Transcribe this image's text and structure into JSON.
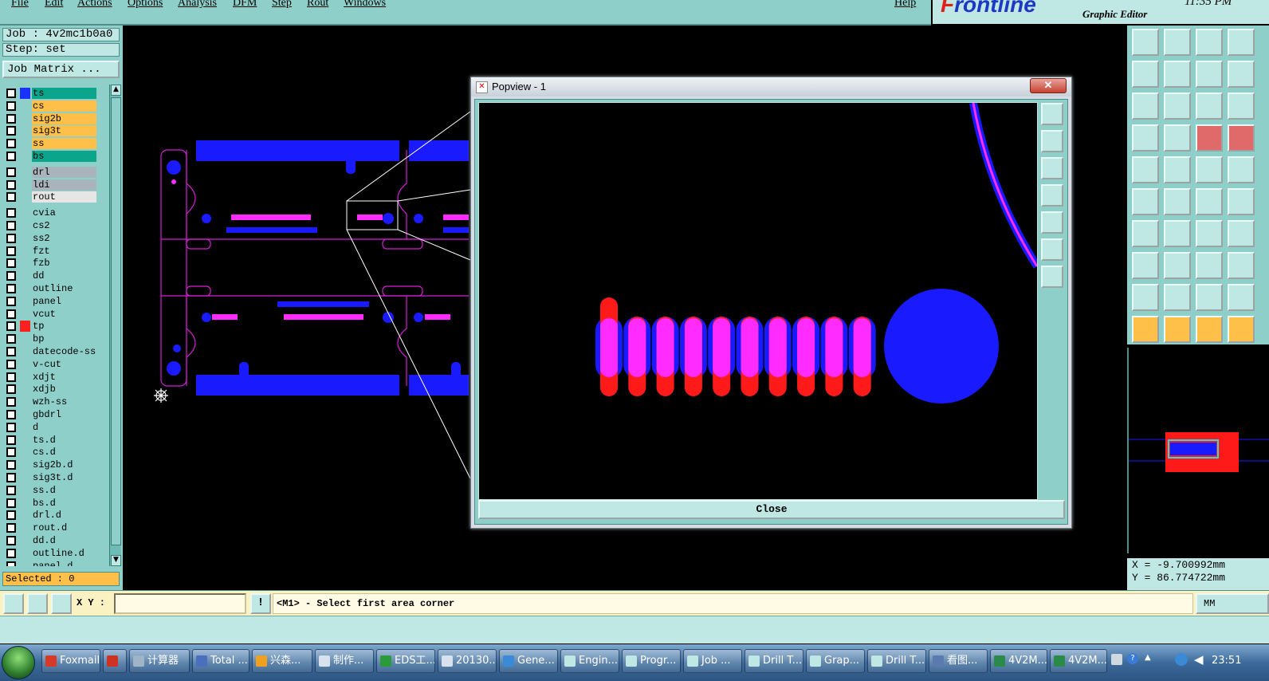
{
  "menu": [
    "File",
    "Edit",
    "Actions",
    "Options",
    "Analysis",
    "DFM",
    "Step",
    "Rout",
    "Windows"
  ],
  "help": "Help",
  "brand": {
    "logo_prefix": "F",
    "logo_rest": "rontline",
    "subtitle": "Graphic Editor",
    "clock": "11:35 PM"
  },
  "job": {
    "job_line": "Job : 4v2mc1b0a0",
    "step_line": "Step: set",
    "matrix_button": "Job Matrix ..."
  },
  "layers": [
    {
      "name": "ts",
      "color": "#0aa58a",
      "swatch": "#1a32ff"
    },
    {
      "name": "cs",
      "color": "#ffc04a",
      "swatch": ""
    },
    {
      "name": "sig2b",
      "color": "#ffc04a",
      "swatch": ""
    },
    {
      "name": "sig3t",
      "color": "#ffc04a",
      "swatch": ""
    },
    {
      "name": "ss",
      "color": "#ffc04a",
      "swatch": ""
    },
    {
      "name": "bs",
      "color": "#0aa58a",
      "swatch": ""
    },
    {
      "name": "drl",
      "color": "#a9b4bc",
      "swatch": ""
    },
    {
      "name": "ldi",
      "color": "#a9b4bc",
      "swatch": ""
    },
    {
      "name": "rout",
      "color": "#e6e6e6",
      "swatch": ""
    },
    {
      "name": "cvia",
      "color": "#8ecfc9",
      "swatch": ""
    },
    {
      "name": "cs2",
      "color": "#8ecfc9",
      "swatch": ""
    },
    {
      "name": "ss2",
      "color": "#8ecfc9",
      "swatch": ""
    },
    {
      "name": "fzt",
      "color": "#8ecfc9",
      "swatch": ""
    },
    {
      "name": "fzb",
      "color": "#8ecfc9",
      "swatch": ""
    },
    {
      "name": "dd",
      "color": "#8ecfc9",
      "swatch": ""
    },
    {
      "name": "outline",
      "color": "#8ecfc9",
      "swatch": ""
    },
    {
      "name": "panel",
      "color": "#8ecfc9",
      "swatch": ""
    },
    {
      "name": "vcut",
      "color": "#8ecfc9",
      "swatch": ""
    },
    {
      "name": "tp",
      "color": "#8ecfc9",
      "swatch": "#ff2020"
    },
    {
      "name": "bp",
      "color": "#8ecfc9",
      "swatch": ""
    },
    {
      "name": "datecode-ss",
      "color": "#8ecfc9",
      "swatch": ""
    },
    {
      "name": "v-cut",
      "color": "#8ecfc9",
      "swatch": ""
    },
    {
      "name": "xdjt",
      "color": "#8ecfc9",
      "swatch": ""
    },
    {
      "name": "xdjb",
      "color": "#8ecfc9",
      "swatch": ""
    },
    {
      "name": "wzh-ss",
      "color": "#8ecfc9",
      "swatch": ""
    },
    {
      "name": "gbdrl",
      "color": "#8ecfc9",
      "swatch": ""
    },
    {
      "name": "d",
      "color": "#8ecfc9",
      "swatch": ""
    },
    {
      "name": "ts.d",
      "color": "#8ecfc9",
      "swatch": ""
    },
    {
      "name": "cs.d",
      "color": "#8ecfc9",
      "swatch": ""
    },
    {
      "name": "sig2b.d",
      "color": "#8ecfc9",
      "swatch": ""
    },
    {
      "name": "sig3t.d",
      "color": "#8ecfc9",
      "swatch": ""
    },
    {
      "name": "ss.d",
      "color": "#8ecfc9",
      "swatch": ""
    },
    {
      "name": "bs.d",
      "color": "#8ecfc9",
      "swatch": ""
    },
    {
      "name": "drl.d",
      "color": "#8ecfc9",
      "swatch": ""
    },
    {
      "name": "rout.d",
      "color": "#8ecfc9",
      "swatch": ""
    },
    {
      "name": "dd.d",
      "color": "#8ecfc9",
      "swatch": ""
    },
    {
      "name": "outline.d",
      "color": "#8ecfc9",
      "swatch": ""
    },
    {
      "name": "panel.d",
      "color": "#8ecfc9",
      "swatch": ""
    }
  ],
  "selected_label": "Selected : 0",
  "popview": {
    "title": "Popview - 1",
    "close_x": "✕",
    "close_button": "Close"
  },
  "coords": {
    "x": "X = -9.700992mm",
    "y": "Y = 86.774722mm"
  },
  "cmd": {
    "xy_label": "X Y :",
    "xy_value": "",
    "prompt": "<M1> - Select first area corner",
    "units": "MM"
  },
  "taskbar": {
    "tasks": [
      {
        "label": "Foxmail",
        "icon": "#d83a2a"
      },
      {
        "label": "",
        "icon": "#cc3322"
      },
      {
        "label": "计算器",
        "icon": "#9fb4c8"
      },
      {
        "label": "Total ...",
        "icon": "#4a6fbe"
      },
      {
        "label": "兴森...",
        "icon": "#f0a020"
      },
      {
        "label": "制作...",
        "icon": "#d8e2ee"
      },
      {
        "label": "EDS工...",
        "icon": "#2a9a3a"
      },
      {
        "label": "20130...",
        "icon": "#d8e2ee"
      },
      {
        "label": "Gene...",
        "icon": "#3a8ad8"
      },
      {
        "label": "Engin...",
        "icon": "#bfe7e3"
      },
      {
        "label": "Progr...",
        "icon": "#bfe7e3"
      },
      {
        "label": "Job ...",
        "icon": "#bfe7e3"
      },
      {
        "label": "Drill T...",
        "icon": "#bfe7e3"
      },
      {
        "label": "Grap...",
        "icon": "#bfe7e3"
      },
      {
        "label": "Drill T...",
        "icon": "#bfe7e3"
      },
      {
        "label": "看图...",
        "icon": "#5a7ab0"
      },
      {
        "label": "4V2M...",
        "icon": "#2a8a4a"
      },
      {
        "label": "4V2M...",
        "icon": "#2a8a4a"
      }
    ],
    "time": "23:51"
  }
}
